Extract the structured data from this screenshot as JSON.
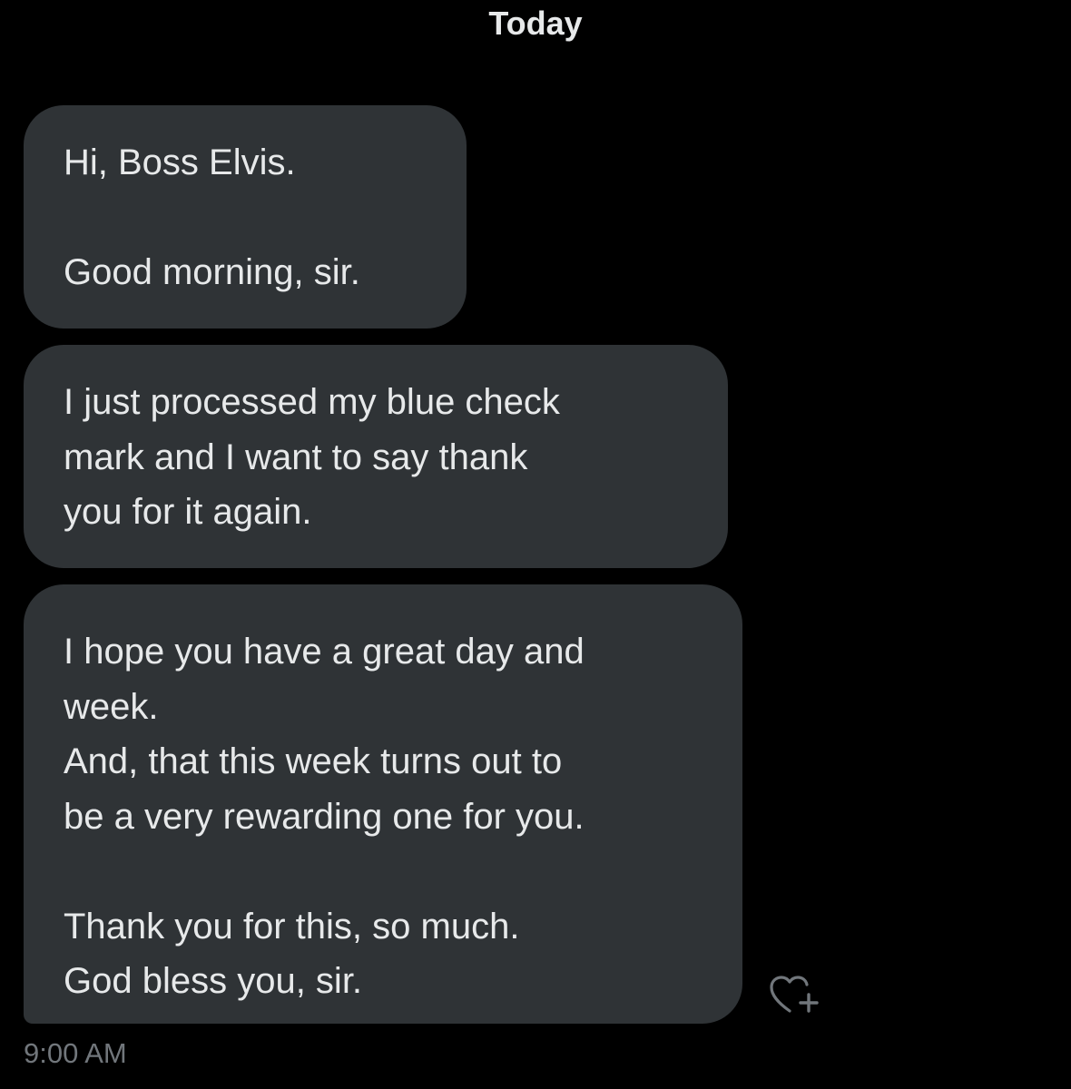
{
  "header": {
    "date_label": "Today"
  },
  "messages": [
    {
      "text": "Hi, Boss Elvis.\n\nGood morning, sir."
    },
    {
      "text": "I just processed my blue check\nmark and I want to say thank\nyou for it again."
    },
    {
      "text": "I hope you have a great day and\nweek.\nAnd, that this week turns out to\nbe a very rewarding one for you.\n\nThank you for this, so much.\nGod bless you, sir."
    }
  ],
  "timestamp": "9:00 AM",
  "icons": {
    "reaction": "heart-plus-icon"
  },
  "colors": {
    "background": "#000000",
    "bubble": "#2f3336",
    "text": "#e7e9ea",
    "secondary_text": "#71767b"
  }
}
